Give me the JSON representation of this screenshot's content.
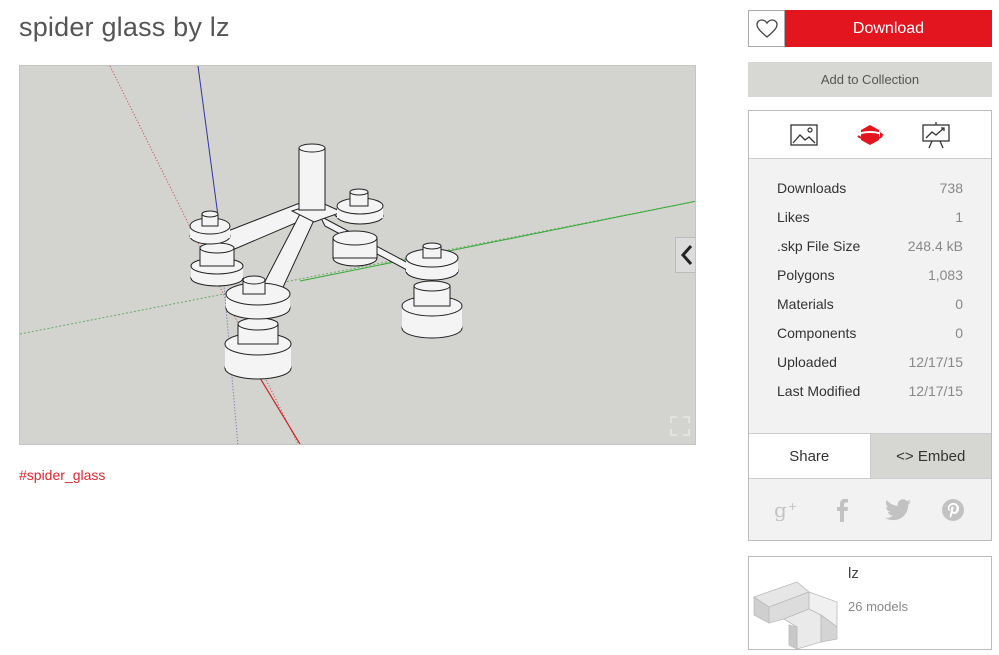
{
  "page": {
    "title": "spider glass by lz"
  },
  "viewer": {
    "tag": "#spider_glass"
  },
  "actions": {
    "download_label": "Download",
    "collection_label": "Add to Collection"
  },
  "stats": [
    {
      "label": "Downloads",
      "value": "738"
    },
    {
      "label": "Likes",
      "value": "1"
    },
    {
      "label": ".skp File Size",
      "value": "248.4 kB"
    },
    {
      "label": "Polygons",
      "value": "1,083"
    },
    {
      "label": "Materials",
      "value": "0"
    },
    {
      "label": "Components",
      "value": "0"
    },
    {
      "label": "Uploaded",
      "value": "12/17/15"
    },
    {
      "label": "Last Modified",
      "value": "12/17/15"
    }
  ],
  "share": {
    "share_label": "Share",
    "embed_label": "<> Embed"
  },
  "social": [
    "google-plus-icon",
    "facebook-icon",
    "twitter-icon",
    "pinterest-icon"
  ],
  "author": {
    "name": "lz",
    "models": "26 models"
  },
  "colors": {
    "accent": "#e3161f",
    "panel_bg": "#f2f2f2",
    "viewport_bg": "#d3d3cf"
  }
}
